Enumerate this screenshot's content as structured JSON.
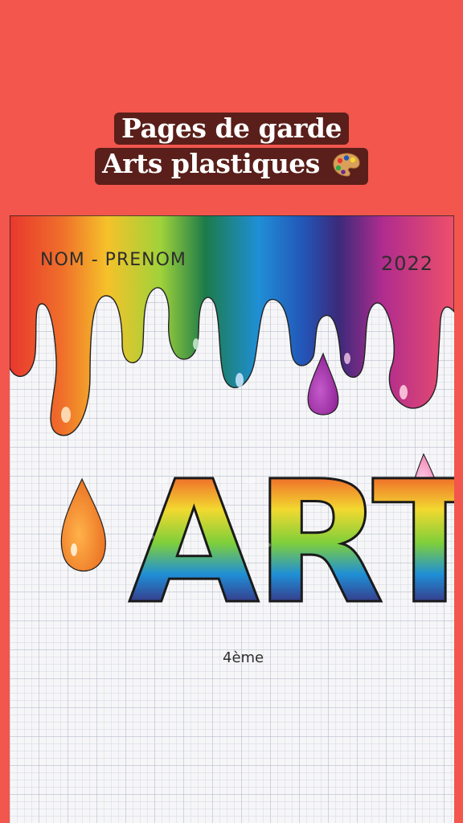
{
  "header": {
    "title_line1": "Pages de garde",
    "title_line2": "Arts plastiques",
    "title_icon": "artist-palette-icon"
  },
  "artwork": {
    "name_label": "NOM - PRENOM",
    "year": "2022",
    "big_word": "ART",
    "grade": "4ème",
    "drip_colors": [
      "#e8372e",
      "#f0702a",
      "#f5a623",
      "#f2d930",
      "#9fd23a",
      "#2fa84a",
      "#1c7b4a",
      "#1f8fd6",
      "#2356b8",
      "#3b2a7a",
      "#6a2a8c",
      "#b02c8e",
      "#e0337a",
      "#ee4f6a"
    ]
  }
}
